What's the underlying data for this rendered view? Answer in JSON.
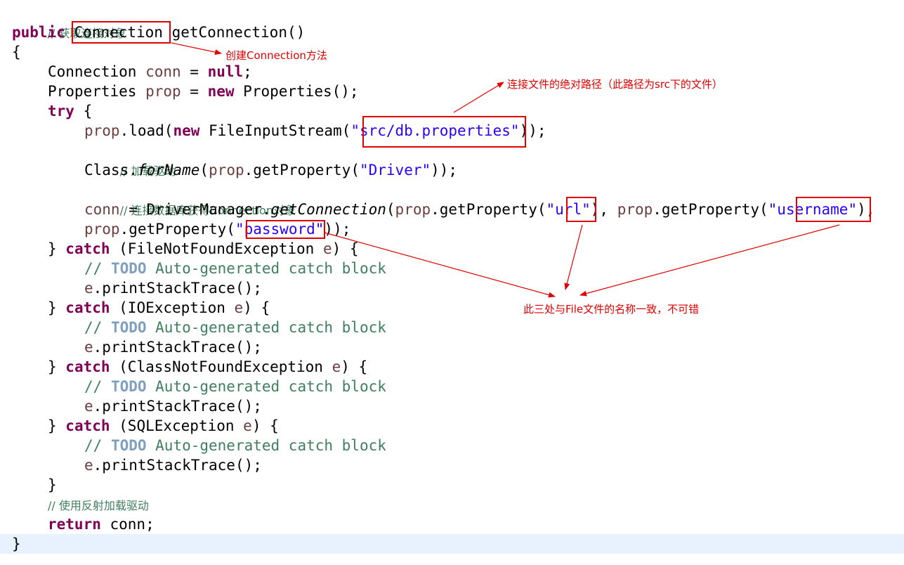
{
  "code": {
    "comment_get_conn": "// 获取连接对象",
    "kw_public": "public",
    "type_connection": "Connection",
    "method_sig": " getConnection()",
    "open_brace": "{",
    "l4_type": "Connection ",
    "l4_var": "conn",
    "l4_eq": " = ",
    "l4_null": "null",
    "semicolon": ";",
    "l5_type": "Properties ",
    "l5_var": "prop",
    "l5_eq": " = ",
    "kw_new": "new",
    "l5_rest": " Properties();",
    "kw_try": "try",
    "try_brace": " {",
    "l7_var": "prop",
    "l7_load": ".load(",
    "l7_fis": " FileInputStream(",
    "quote": "\"",
    "str_path": "src/db.properties",
    "l7_end": "));",
    "comment_load_driver": "// 加载驱动",
    "l9_class": "Class.",
    "l9_forname": "forName",
    "l9_open": "(",
    "l9_getprop": ".getProperty(",
    "str_driver": "\"Driver\"",
    "l9_end": "));",
    "comment_connect_db": "// 连接数据库获得Connection对象",
    "l11_var": "conn",
    "l11_eq": " = DriverManager.",
    "l11_getconn": "getConnection",
    "l11_open": "(",
    "l11_getprop": ".getProperty(",
    "str_url": "url",
    "l11_mid": "), ",
    "l11_getprop2": ".getProperty(",
    "str_username": "username",
    "l11_end": "),",
    "l12_getprop": ".getProperty(",
    "str_password": "password",
    "l12_end": "));",
    "close_brace_catch": "} ",
    "kw_catch": "catch",
    "exc_1": " (FileNotFoundException ",
    "exc_2": " (IOException ",
    "exc_3": " (ClassNotFoundException ",
    "exc_4": " (SQLException ",
    "exc_var": "e",
    "exc_end": ") {",
    "comment_prefix": "// ",
    "todo": "TODO",
    "todo_text": " Auto-generated catch block",
    "print_var": "e",
    "print_trace": ".printStackTrace();",
    "close_brace": "}",
    "comment_reflect": "// 使用反射加载驱动",
    "kw_return": "return",
    "return_rest": " conn;",
    "final_brace": "}"
  },
  "annotations": {
    "create_method": "创建Connection方法",
    "abs_path": "连接文件的绝对路径（此路径为src下的文件）",
    "consistent_names": "此三处与File文件的名称一致，不可错"
  },
  "colors": {
    "keyword": "#7f0055",
    "string": "#2a00ff",
    "comment": "#3f7f5f",
    "todo": "#7f9fbf",
    "annotation": "#e00000",
    "current_line": "#e8f2fe"
  }
}
